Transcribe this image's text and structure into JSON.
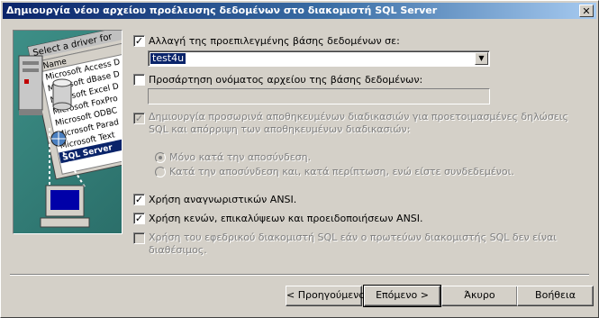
{
  "window": {
    "title": "Δημιουργία νέου αρχείου προέλευσης δεδομένων στο διακομιστή SQL Server",
    "close_glyph": "✕"
  },
  "illustration": {
    "panel_title": "Select a driver for",
    "column_label": "Name",
    "drivers": [
      "Microsoft Access D",
      "Microsoft dBase D",
      "Microsoft Excel D",
      "Microsoft FoxPro",
      "Microsoft ODBC",
      "Microsoft Parad",
      "Microsoft Text",
      "SQL Server"
    ],
    "selected_driver": "SQL Server"
  },
  "options": {
    "change_default_db": {
      "label": "Αλλαγή της προεπιλεγμένης βάσης δεδομένων σε:",
      "checked": true,
      "value": "test4u"
    },
    "attach_db_file": {
      "label": "Προσάρτηση ονόματος αρχείου της βάσης δεδομένων:",
      "checked": false,
      "value": ""
    },
    "create_temp_procs": {
      "label": "Δημιουργία προσωρινά αποθηκευμένων διαδικασιών για προετοιμασμένες δηλώσεις SQL και απόρριψη των αποθηκευμένων διαδικασιών:",
      "checked": true,
      "disabled": true
    },
    "radio_only_disconnect": {
      "label": "Μόνο κατά την αποσύνδεση."
    },
    "radio_disconnect_and_when": {
      "label": "Κατά την αποσύνδεση και, κατά περίπτωση, ενώ είστε συνδεδεμένοι."
    },
    "ansi_quoted": {
      "label": "Χρήση αναγνωριστικών ANSI.",
      "checked": true
    },
    "ansi_nulls": {
      "label": "Χρήση κενών, επικαλύψεων και προειδοποιήσεων ANSI.",
      "checked": true
    },
    "failover": {
      "label": "Χρήση του εφεδρικού διακομιστή SQL εάν ο πρωτεύων διακομιστής SQL δεν είναι διαθέσιμος.",
      "checked": false,
      "disabled": true
    }
  },
  "buttons": {
    "back": "< Προηγούμενο",
    "next": "Επόμενο >",
    "cancel": "Άκυρο",
    "help": "Βοήθεια"
  }
}
